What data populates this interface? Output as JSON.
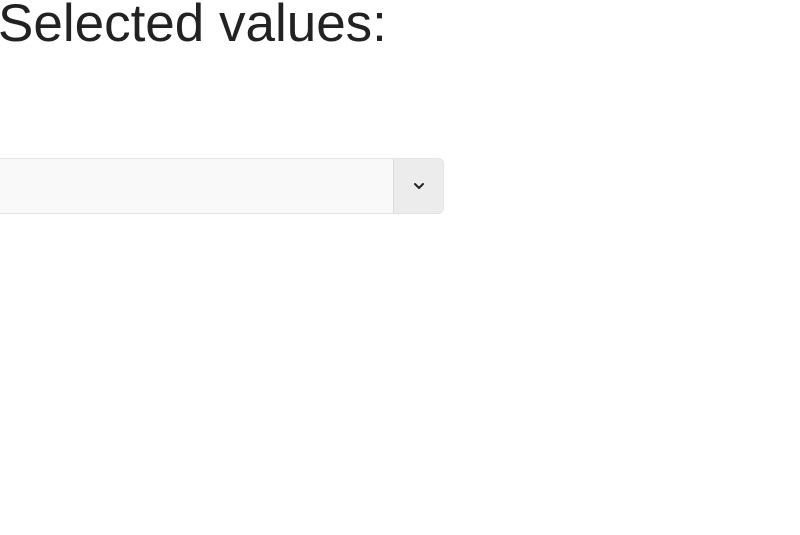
{
  "heading": {
    "text": "Selected values:"
  },
  "multiselect": {
    "value": "",
    "toggle_icon": "chevron-down-icon"
  },
  "colors": {
    "field_background": "#f9f9f9",
    "field_border": "#e4e4e4",
    "toggle_background": "#ececec",
    "text": "#222222"
  }
}
